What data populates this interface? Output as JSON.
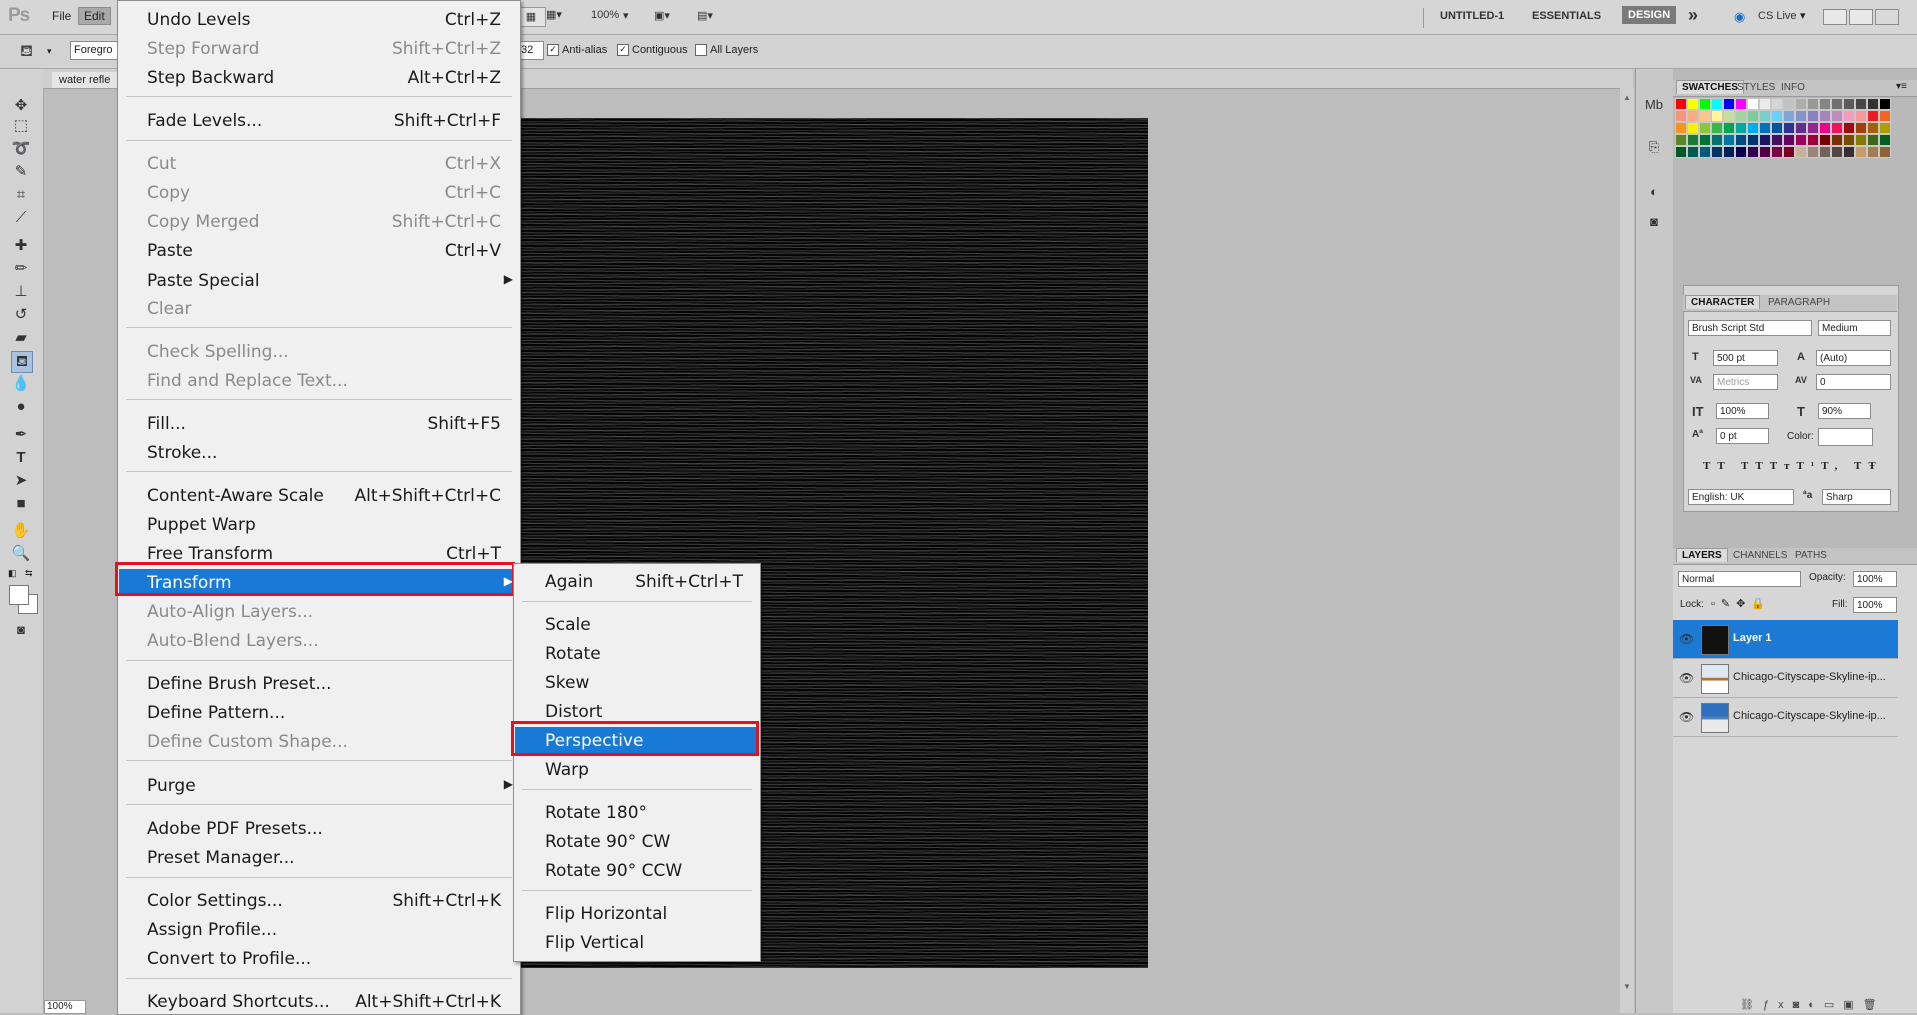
{
  "app": {
    "logo": "Ps"
  },
  "menubar": {
    "file": "File",
    "edit": "Edit",
    "zoom": "100%",
    "workspaces": [
      "UNTITLED-1",
      "ESSENTIALS",
      "DESIGN"
    ],
    "more": "»",
    "cslive": "CS Live"
  },
  "options": {
    "fill_source": "Foregro",
    "tolerance": "32",
    "anti_alias": "Anti-alias",
    "contiguous": "Contiguous",
    "all_layers": "All Layers"
  },
  "document": {
    "tab_title": "water refle",
    "zoom": "100%"
  },
  "edit_menu": {
    "items": [
      {
        "label": "Undo Levels",
        "shortcut": "Ctrl+Z",
        "enabled": true
      },
      {
        "label": "Step Forward",
        "shortcut": "Shift+Ctrl+Z",
        "enabled": false
      },
      {
        "label": "Step Backward",
        "shortcut": "Alt+Ctrl+Z",
        "enabled": true
      },
      {
        "label": "Fade Levels...",
        "shortcut": "Shift+Ctrl+F",
        "enabled": true
      },
      {
        "label": "Cut",
        "shortcut": "Ctrl+X",
        "enabled": false
      },
      {
        "label": "Copy",
        "shortcut": "Ctrl+C",
        "enabled": false
      },
      {
        "label": "Copy Merged",
        "shortcut": "Shift+Ctrl+C",
        "enabled": false
      },
      {
        "label": "Paste",
        "shortcut": "Ctrl+V",
        "enabled": true
      },
      {
        "label": "Paste Special",
        "shortcut": "",
        "enabled": true
      },
      {
        "label": "Clear",
        "shortcut": "",
        "enabled": false
      },
      {
        "label": "Check Spelling...",
        "shortcut": "",
        "enabled": false
      },
      {
        "label": "Find and Replace Text...",
        "shortcut": "",
        "enabled": false
      },
      {
        "label": "Fill...",
        "shortcut": "Shift+F5",
        "enabled": true
      },
      {
        "label": "Stroke...",
        "shortcut": "",
        "enabled": true
      },
      {
        "label": "Content-Aware Scale",
        "shortcut": "Alt+Shift+Ctrl+C",
        "enabled": true
      },
      {
        "label": "Puppet Warp",
        "shortcut": "",
        "enabled": true
      },
      {
        "label": "Free Transform",
        "shortcut": "Ctrl+T",
        "enabled": true
      },
      {
        "label": "Transform",
        "shortcut": "",
        "enabled": true
      },
      {
        "label": "Auto-Align Layers...",
        "shortcut": "",
        "enabled": false
      },
      {
        "label": "Auto-Blend Layers...",
        "shortcut": "",
        "enabled": false
      },
      {
        "label": "Define Brush Preset...",
        "shortcut": "",
        "enabled": true
      },
      {
        "label": "Define Pattern...",
        "shortcut": "",
        "enabled": true
      },
      {
        "label": "Define Custom Shape...",
        "shortcut": "",
        "enabled": false
      },
      {
        "label": "Purge",
        "shortcut": "",
        "enabled": true
      },
      {
        "label": "Adobe PDF Presets...",
        "shortcut": "",
        "enabled": true
      },
      {
        "label": "Preset Manager...",
        "shortcut": "",
        "enabled": true
      },
      {
        "label": "Color Settings...",
        "shortcut": "Shift+Ctrl+K",
        "enabled": true
      },
      {
        "label": "Assign Profile...",
        "shortcut": "",
        "enabled": true
      },
      {
        "label": "Convert to Profile...",
        "shortcut": "",
        "enabled": true
      },
      {
        "label": "Keyboard Shortcuts...",
        "shortcut": "Alt+Shift+Ctrl+K",
        "enabled": true
      }
    ]
  },
  "transform_menu": {
    "items": [
      {
        "label": "Again",
        "shortcut": "Shift+Ctrl+T"
      },
      {
        "label": "Scale",
        "shortcut": ""
      },
      {
        "label": "Rotate",
        "shortcut": ""
      },
      {
        "label": "Skew",
        "shortcut": ""
      },
      {
        "label": "Distort",
        "shortcut": ""
      },
      {
        "label": "Perspective",
        "shortcut": ""
      },
      {
        "label": "Warp",
        "shortcut": ""
      },
      {
        "label": "Rotate 180°",
        "shortcut": ""
      },
      {
        "label": "Rotate 90° CW",
        "shortcut": ""
      },
      {
        "label": "Rotate 90° CCW",
        "shortcut": ""
      },
      {
        "label": "Flip Horizontal",
        "shortcut": ""
      },
      {
        "label": "Flip Vertical",
        "shortcut": ""
      }
    ]
  },
  "swatches_panel": {
    "tabs": [
      "SWATCHES",
      "STYLES",
      "INFO"
    ]
  },
  "character_panel": {
    "tabs": [
      "CHARACTER",
      "PARAGRAPH"
    ],
    "font_family": "Brush Script Std",
    "font_style": "Medium",
    "font_size": "500 pt",
    "leading": "(Auto)",
    "kerning": "Metrics",
    "tracking": "0",
    "vertical_scale": "100%",
    "horizontal_scale": "90%",
    "baseline_shift": "0 pt",
    "color_label": "Color:",
    "language": "English: UK",
    "antialias": "Sharp",
    "style_buttons": [
      "T",
      "T",
      "TT",
      "Tт",
      "T¹",
      "T,",
      "T",
      "Ŧ"
    ]
  },
  "layers_panel": {
    "tabs": [
      "LAYERS",
      "CHANNELS",
      "PATHS"
    ],
    "blend_mode": "Normal",
    "opacity_label": "Opacity:",
    "opacity": "100%",
    "lock_label": "Lock:",
    "fill_label": "Fill:",
    "fill": "100%",
    "layers": [
      {
        "name": "Layer 1",
        "selected": true
      },
      {
        "name": "Chicago-Cityscape-Skyline-ip...",
        "selected": false
      },
      {
        "name": "Chicago-Cityscape-Skyline-ip...",
        "selected": false
      }
    ]
  },
  "colors": {
    "highlight": "#1979d6",
    "callout": "#e0141e"
  }
}
